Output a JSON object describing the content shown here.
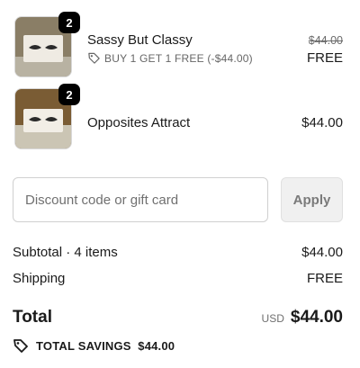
{
  "cart": {
    "items": [
      {
        "title": "Sassy But Classy",
        "quantity": "2",
        "promo_text": "BUY 1 GET 1 FREE (-$44.00)",
        "original_price": "$44.00",
        "price": "FREE"
      },
      {
        "title": "Opposites Attract",
        "quantity": "2",
        "price": "$44.00"
      }
    ]
  },
  "discount": {
    "placeholder": "Discount code or gift card",
    "apply_label": "Apply"
  },
  "summary": {
    "subtotal_label": "Subtotal · 4 items",
    "subtotal_value": "$44.00",
    "shipping_label": "Shipping",
    "shipping_value": "FREE",
    "total_label": "Total",
    "currency": "USD",
    "total_value": "$44.00",
    "savings_text": "TOTAL SAVINGS  $44.00"
  },
  "icons": {
    "promo": "tag-icon",
    "savings": "tag-icon"
  }
}
